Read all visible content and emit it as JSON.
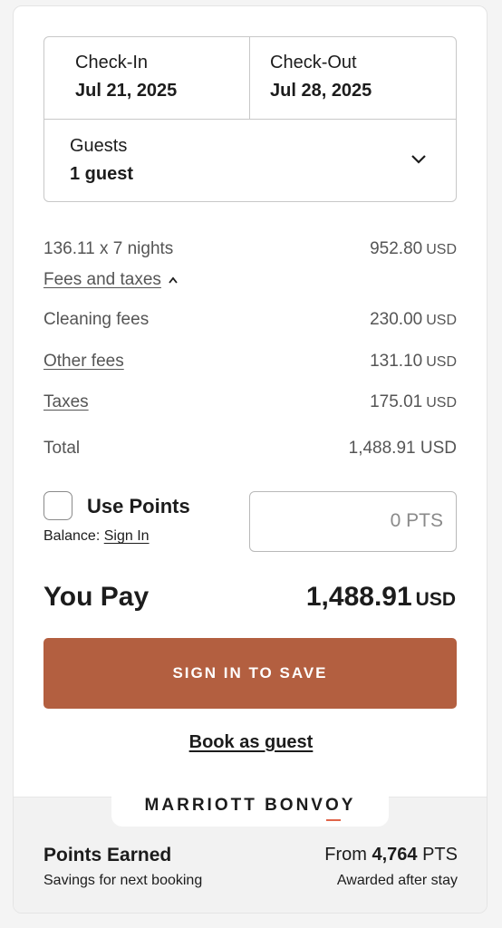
{
  "booking": {
    "checkin_label": "Check-In",
    "checkin_value": "Jul 21, 2025",
    "checkout_label": "Check-Out",
    "checkout_value": "Jul 28, 2025",
    "guests_label": "Guests",
    "guests_value": "1 guest"
  },
  "pricing": {
    "nightly_label": "136.11 x 7 nights",
    "nightly_amount": "952.80",
    "fees_toggle_label": "Fees and taxes",
    "cleaning_label": "Cleaning fees",
    "cleaning_amount": "230.00",
    "other_label": "Other fees",
    "other_amount": "131.10",
    "taxes_label": "Taxes",
    "taxes_amount": "175.01",
    "total_label": "Total",
    "total_amount": "1,488.91 USD",
    "currency": "USD"
  },
  "points": {
    "use_label": "Use Points",
    "balance_label": "Balance:",
    "balance_link": "Sign In",
    "input_value": "0 PTS"
  },
  "summary": {
    "you_pay_label": "You Pay",
    "you_pay_amount": "1,488.91",
    "currency": "USD"
  },
  "actions": {
    "primary_label": "SIGN IN TO SAVE",
    "guest_label": "Book as guest"
  },
  "bonvoy": {
    "brand_part1": "MARRIOTT BONV",
    "brand_o": "O",
    "brand_part2": "Y",
    "title": "Points Earned",
    "subtitle": "Savings for next booking",
    "from_label": "From",
    "points_value": "4,764",
    "points_unit": "PTS",
    "note": "Awarded after stay"
  },
  "colors": {
    "accent": "#b35f40",
    "brand_o_underline": "#e0654a"
  },
  "icons": {
    "guests_dropdown": "chevron-down-icon",
    "fees_toggle": "chevron-up-icon"
  }
}
